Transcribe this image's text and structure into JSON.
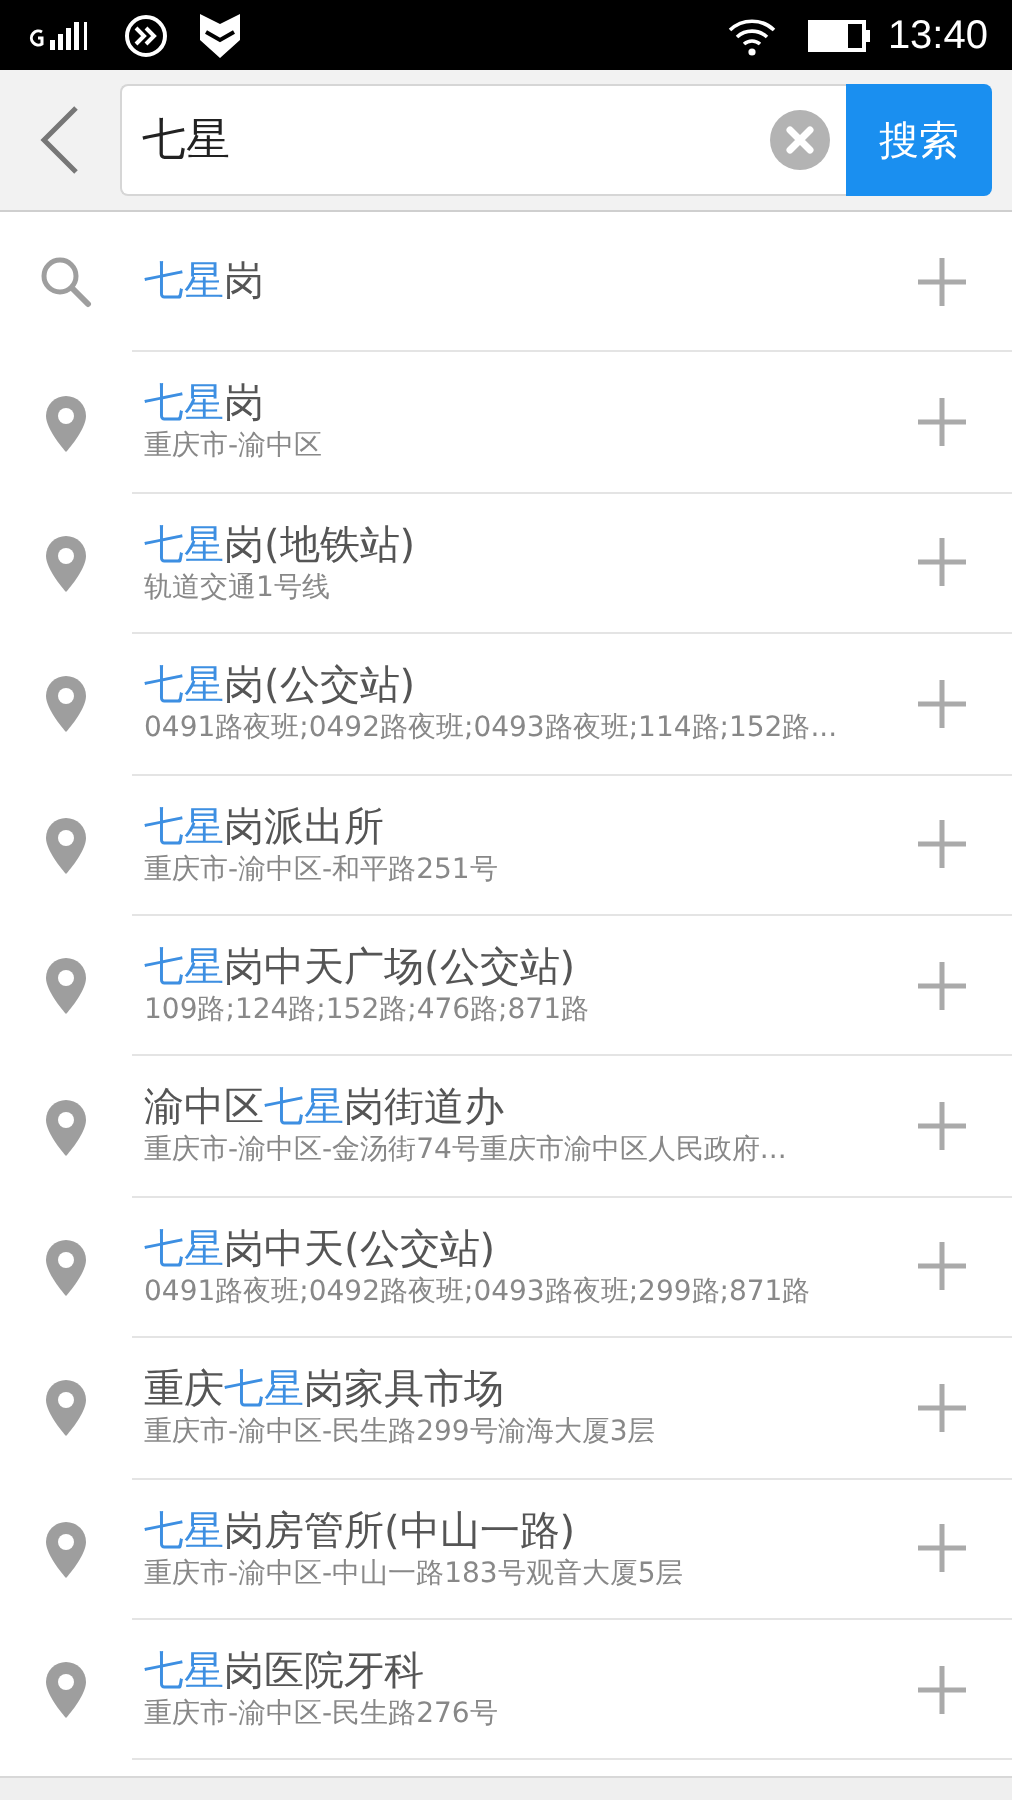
{
  "status_bar": {
    "time": "13:40"
  },
  "search": {
    "value": "七星",
    "button": "搜索"
  },
  "results": [
    {
      "kind": "search",
      "title": [
        {
          "text": "七星",
          "highlight": true
        },
        {
          "text": "岗",
          "highlight": false
        }
      ]
    },
    {
      "kind": "place",
      "title": [
        {
          "text": "七星",
          "highlight": true
        },
        {
          "text": "岗",
          "highlight": false
        }
      ],
      "subtitle": "重庆市-渝中区"
    },
    {
      "kind": "place",
      "title": [
        {
          "text": "七星",
          "highlight": true
        },
        {
          "text": "岗(地铁站)",
          "highlight": false
        }
      ],
      "subtitle": "轨道交通1号线"
    },
    {
      "kind": "place",
      "title": [
        {
          "text": "七星",
          "highlight": true
        },
        {
          "text": "岗(公交站)",
          "highlight": false
        }
      ],
      "subtitle": "0491路夜班;0492路夜班;0493路夜班;114路;152路..."
    },
    {
      "kind": "place",
      "title": [
        {
          "text": "七星",
          "highlight": true
        },
        {
          "text": "岗派出所",
          "highlight": false
        }
      ],
      "subtitle": "重庆市-渝中区-和平路251号"
    },
    {
      "kind": "place",
      "title": [
        {
          "text": "七星",
          "highlight": true
        },
        {
          "text": "岗中天广场(公交站)",
          "highlight": false
        }
      ],
      "subtitle": "109路;124路;152路;476路;871路"
    },
    {
      "kind": "place",
      "title": [
        {
          "text": "渝中区",
          "highlight": false
        },
        {
          "text": "七星",
          "highlight": true
        },
        {
          "text": "岗街道办",
          "highlight": false
        }
      ],
      "subtitle": "重庆市-渝中区-金汤街74号重庆市渝中区人民政府..."
    },
    {
      "kind": "place",
      "title": [
        {
          "text": "七星",
          "highlight": true
        },
        {
          "text": "岗中天(公交站)",
          "highlight": false
        }
      ],
      "subtitle": "0491路夜班;0492路夜班;0493路夜班;299路;871路"
    },
    {
      "kind": "place",
      "title": [
        {
          "text": "重庆",
          "highlight": false
        },
        {
          "text": "七星",
          "highlight": true
        },
        {
          "text": "岗家具市场",
          "highlight": false
        }
      ],
      "subtitle": "重庆市-渝中区-民生路299号渝海大厦3层"
    },
    {
      "kind": "place",
      "title": [
        {
          "text": "七星",
          "highlight": true
        },
        {
          "text": "岗房管所(中山一路)",
          "highlight": false
        }
      ],
      "subtitle": "重庆市-渝中区-中山一路183号观音大厦5层"
    },
    {
      "kind": "place",
      "title": [
        {
          "text": "七星",
          "highlight": true
        },
        {
          "text": "岗医院牙科",
          "highlight": false
        }
      ],
      "subtitle": "重庆市-渝中区-民生路276号"
    }
  ]
}
